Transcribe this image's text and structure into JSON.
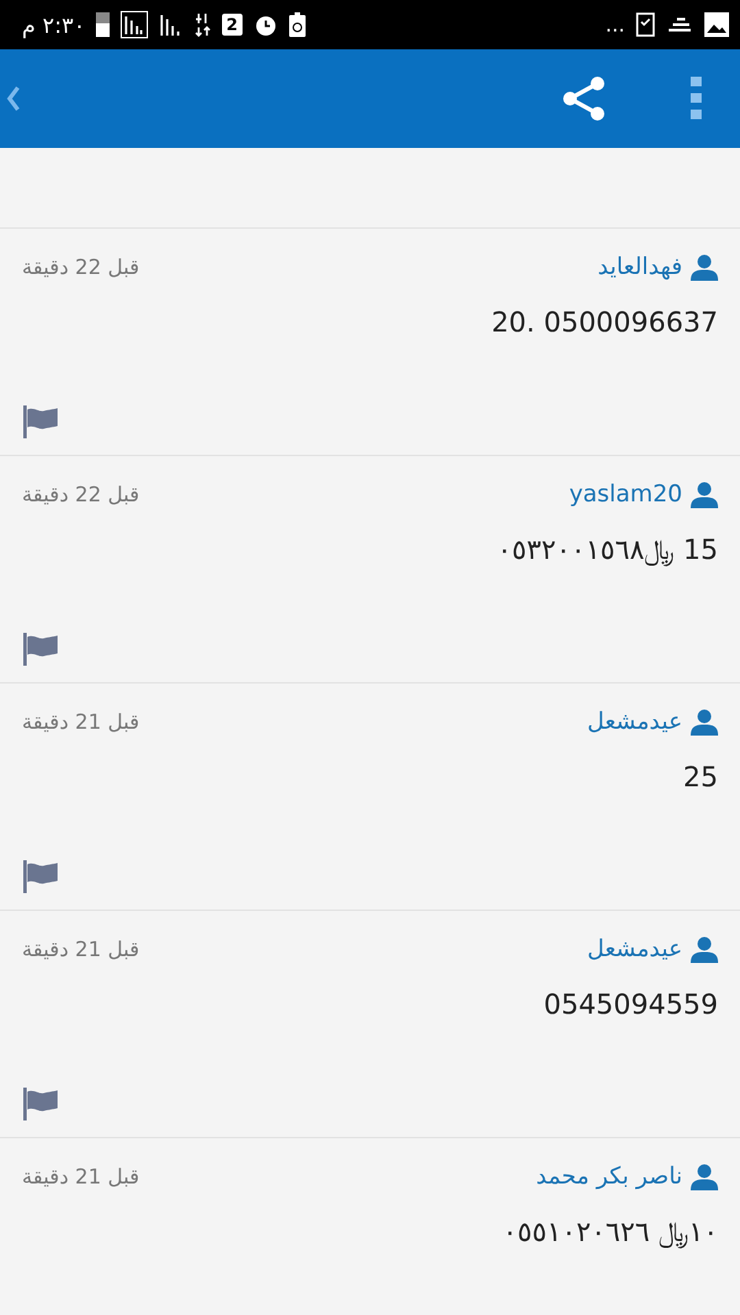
{
  "status_bar": {
    "time": "٢:٣٠ م",
    "sim": "2",
    "more": "..."
  },
  "comments": [
    {
      "author": "فهدالعايد",
      "time": "قبل 22 دقيقة",
      "text": "20. 0500096637"
    },
    {
      "author": "yaslam20",
      "time": "قبل 22 دقيقة",
      "text": "15 ﷼٠٥٣٢٠٠١٥٦٨"
    },
    {
      "author": "عيدمشعل",
      "time": "قبل 21 دقيقة",
      "text": "25"
    },
    {
      "author": "عيدمشعل",
      "time": "قبل 21 دقيقة",
      "text": "0545094559"
    },
    {
      "author": "ناصر بكر محمد",
      "time": "قبل 21 دقيقة",
      "text": "١٠﷼ ٠٥٥١٠٢٠٦٢٦"
    }
  ]
}
